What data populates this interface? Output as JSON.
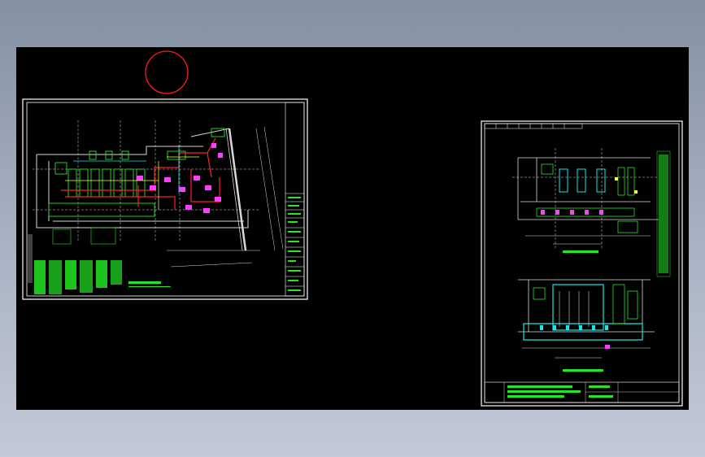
{
  "viewport": {
    "background": "#000000",
    "frame_background": "#8b98aa"
  },
  "colors": {
    "frame": "#ffffff",
    "wall": "#d8d8d8",
    "green": "#22e622",
    "red": "#ff2020",
    "magenta": "#ff3cff",
    "cyan": "#19e6e6",
    "yellow": "#ffff33",
    "marker": "#ff1a1a"
  },
  "marker": {
    "name": "red-circle-marker"
  },
  "sheets": [
    {
      "name": "sheet-left-floor-plan",
      "caption": ""
    },
    {
      "name": "sheet-right-sections",
      "caption": ""
    }
  ]
}
